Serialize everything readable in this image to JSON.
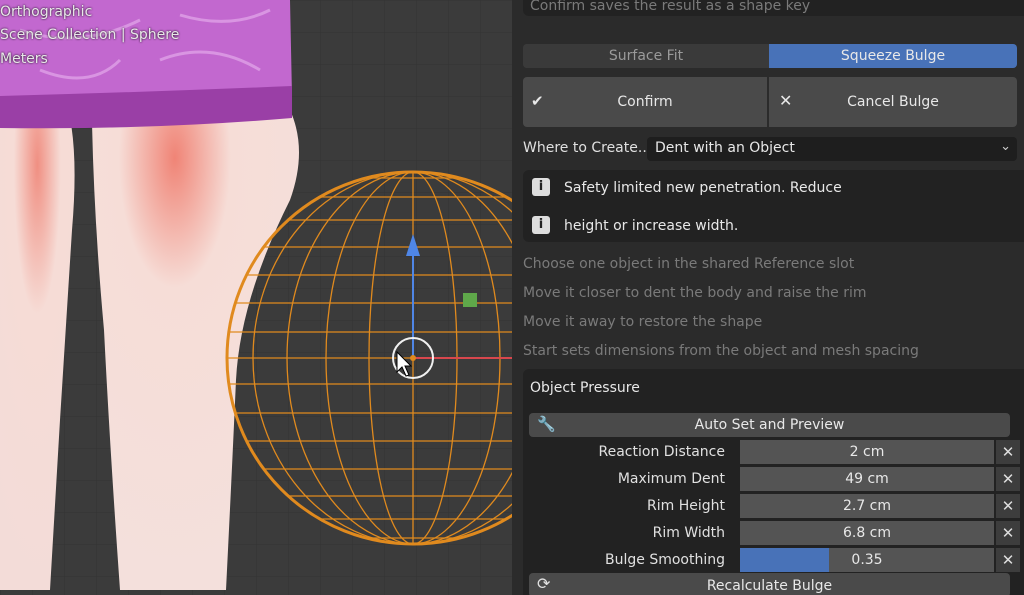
{
  "viewport": {
    "view_mode": "Orthographic",
    "collection_path": "Scene Collection | Sphere",
    "units": "Meters"
  },
  "panel": {
    "top_hint": "Confirm saves the result as a shape key",
    "tabs": [
      {
        "label": "Surface Fit",
        "active": false
      },
      {
        "label": "Squeeze Bulge",
        "active": true
      }
    ],
    "confirm_label": "Confirm",
    "cancel_label": "Cancel Bulge",
    "where_label": "Where to Create...",
    "where_value": "Dent with an Object",
    "warnings": [
      "Safety limited new penetration. Reduce",
      "height or increase width."
    ],
    "help_lines": [
      "Choose one object in the shared Reference slot",
      "Move it closer to dent the body and raise the rim",
      "Move it away to restore the shape",
      "Start sets dimensions from the object and mesh spacing"
    ],
    "section_title": "Object Pressure",
    "auto_set_label": "Auto Set and Preview",
    "properties": [
      {
        "label": "Reaction Distance",
        "value": "2 cm"
      },
      {
        "label": "Maximum Dent",
        "value": "49 cm"
      },
      {
        "label": "Rim Height",
        "value": "2.7 cm"
      },
      {
        "label": "Rim Width",
        "value": "6.8 cm"
      },
      {
        "label": "Bulge Smoothing",
        "value": "0.35",
        "fraction": 0.35
      }
    ],
    "recalc_label": "Recalculate Bulge"
  },
  "colors": {
    "accent": "#4872b8",
    "wire": "#e08a1e",
    "panel_bg": "#2b2b2b",
    "field_bg": "#545454"
  }
}
